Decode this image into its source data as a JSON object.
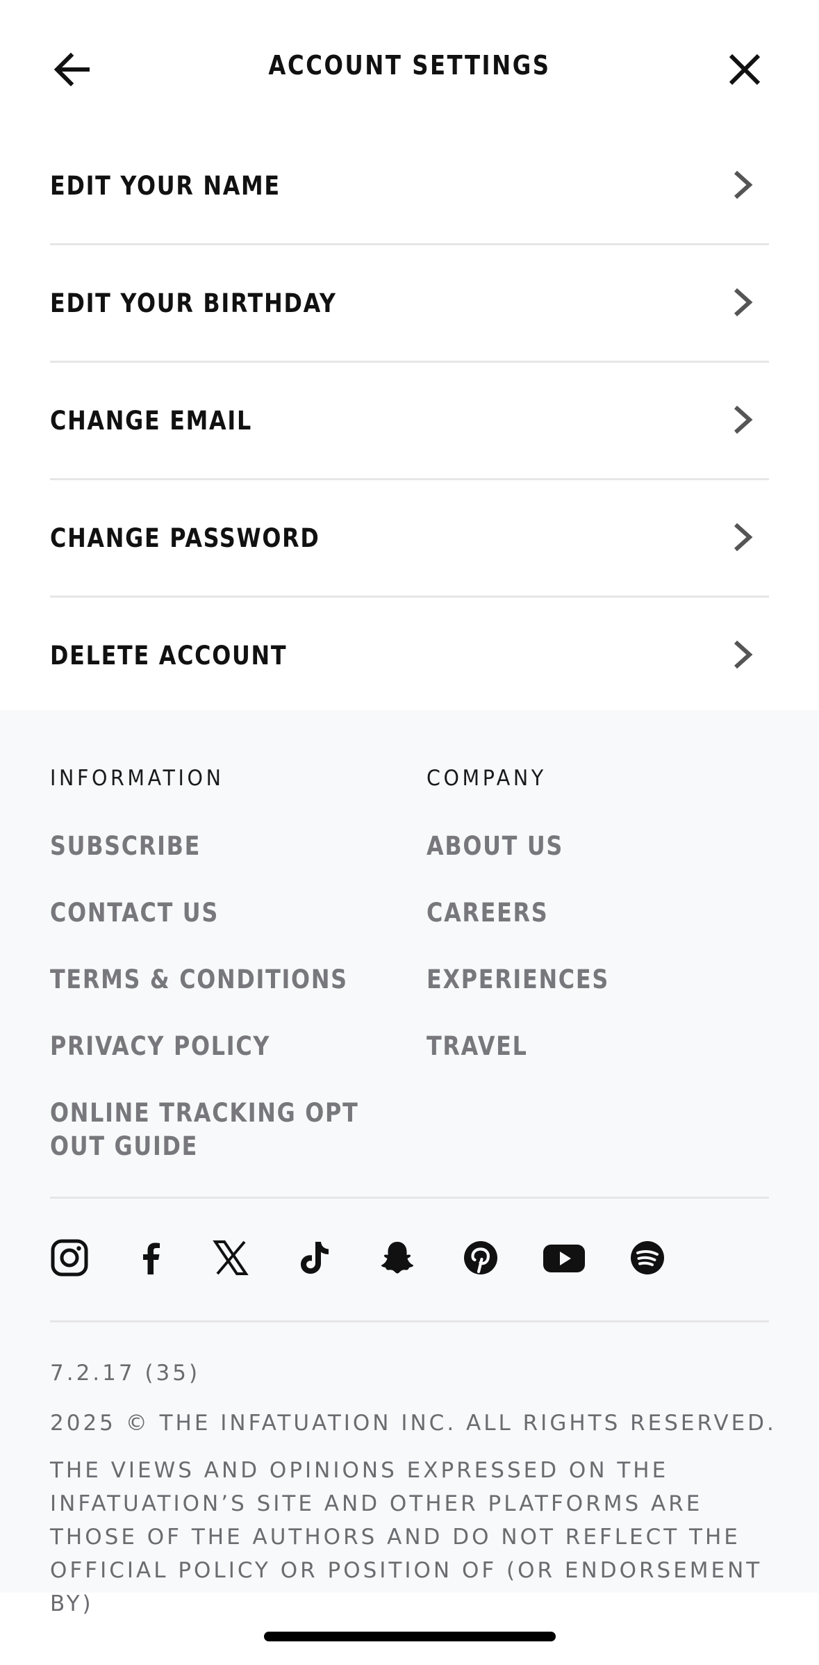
{
  "header": {
    "title": "ACCOUNT SETTINGS",
    "back_icon": "arrow-left-icon",
    "close_icon": "close-icon"
  },
  "menu": {
    "items": [
      {
        "label": "EDIT YOUR NAME"
      },
      {
        "label": "EDIT YOUR BIRTHDAY"
      },
      {
        "label": "CHANGE EMAIL"
      },
      {
        "label": "CHANGE PASSWORD"
      },
      {
        "label": "DELETE ACCOUNT"
      }
    ]
  },
  "footer": {
    "information": {
      "heading": "INFORMATION",
      "links": [
        "SUBSCRIBE",
        "CONTACT US",
        "TERMS & CONDITIONS",
        "PRIVACY POLICY",
        "ONLINE TRACKING OPT OUT GUIDE"
      ]
    },
    "company": {
      "heading": "COMPANY",
      "links": [
        "ABOUT US",
        "CAREERS",
        "EXPERIENCES",
        "TRAVEL"
      ]
    },
    "socials": [
      "instagram-icon",
      "facebook-icon",
      "x-icon",
      "tiktok-icon",
      "snapchat-icon",
      "pinterest-icon",
      "youtube-icon",
      "spotify-icon"
    ],
    "version": "7.2.17 (35)",
    "copyright": "2025 © THE INFATUATION INC. ALL RIGHTS RESERVED.",
    "disclaimer": "THE VIEWS AND OPINIONS EXPRESSED ON THE INFATUATION’S SITE AND OTHER PLATFORMS ARE THOSE OF THE AUTHORS AND DO NOT REFLECT THE OFFICIAL POLICY OR POSITION OF (OR ENDORSEMENT BY)"
  }
}
